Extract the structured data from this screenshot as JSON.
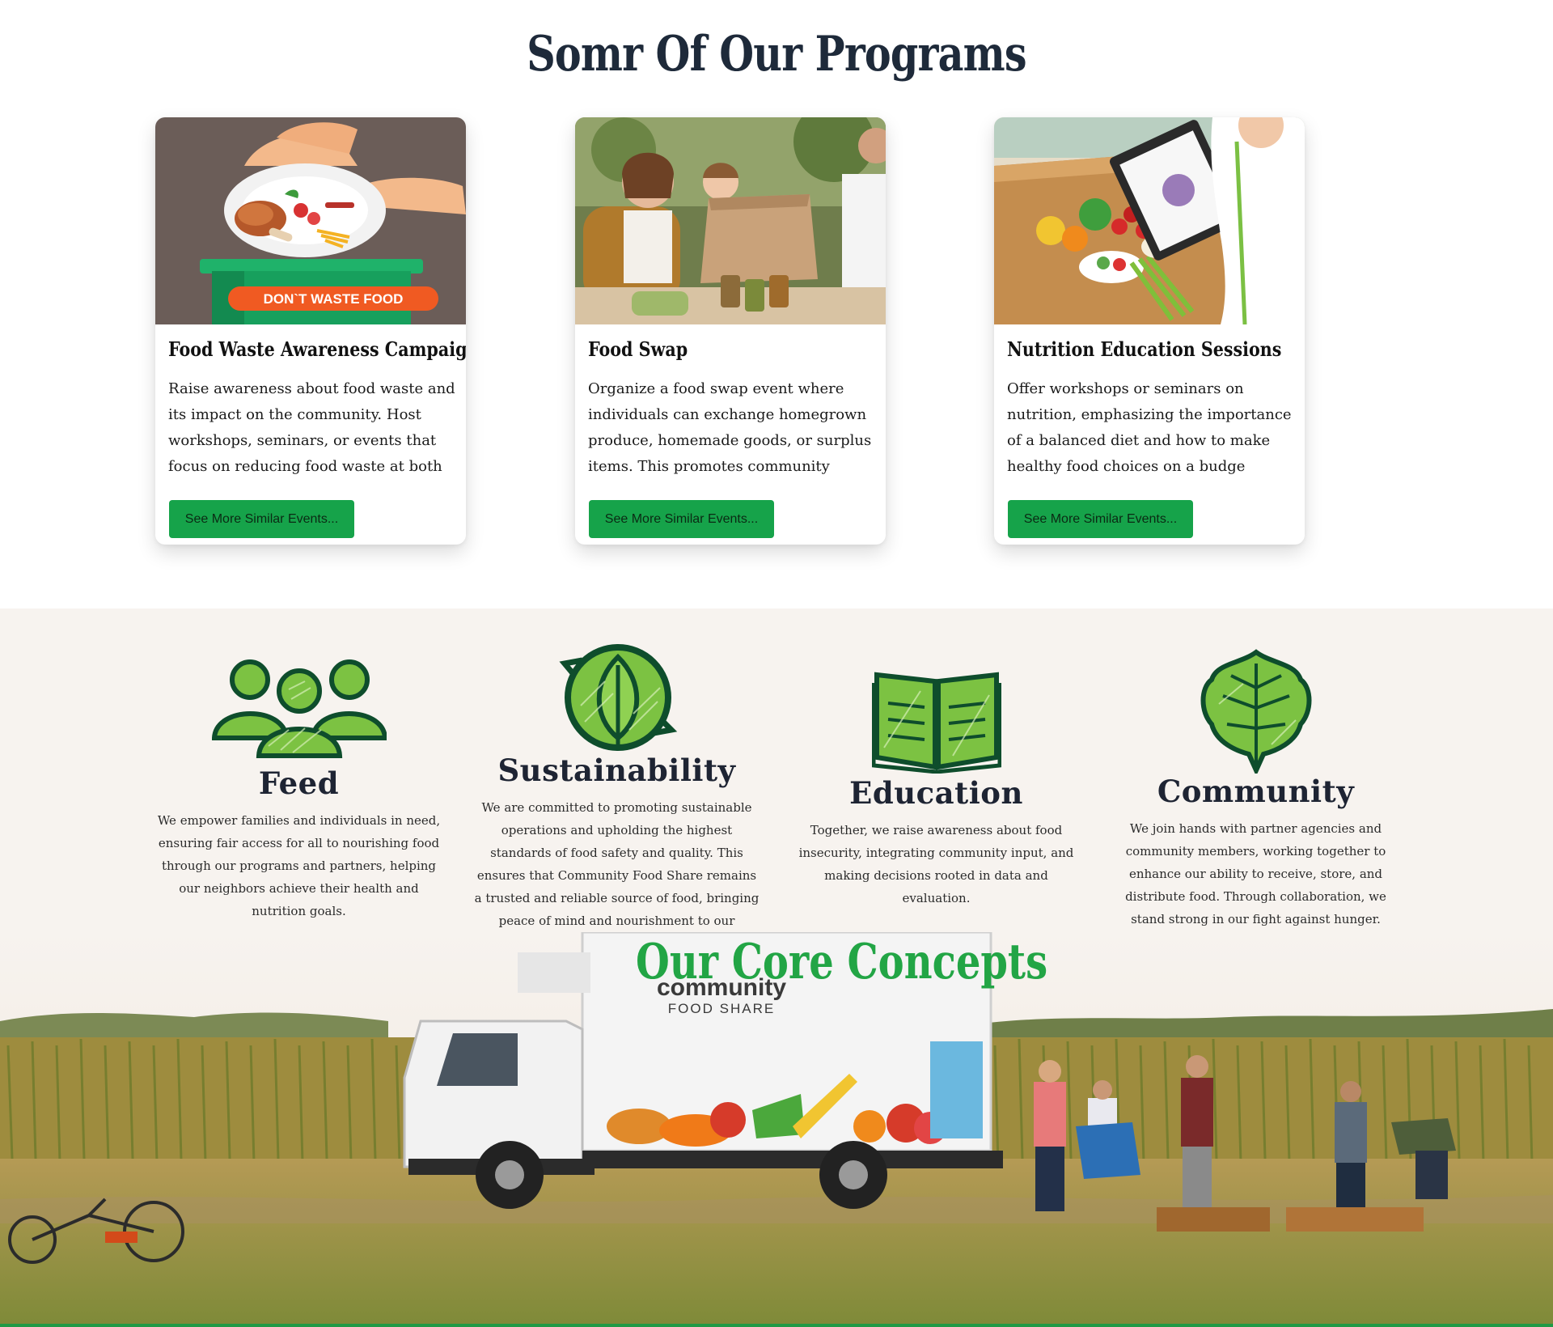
{
  "programs": {
    "title": "Somr Of Our Programs",
    "cards": [
      {
        "image": "dont-waste-food-illustration",
        "image_text": "DON`T WASTE FOOD",
        "title": "Food Waste Awareness Campaign",
        "text": "Raise awareness about food waste and its impact on the community. Host workshops, seminars, or events that focus on reducing food waste at both the individual and community",
        "button": "See More Similar Events..."
      },
      {
        "image": "food-swap-photo",
        "title": "Food Swap",
        "text": "Organize a food swap event where individuals can exchange homegrown produce, homemade goods, or surplus items. This promotes community sharing and reduces food waste",
        "button": "See More Similar Events..."
      },
      {
        "image": "nutrition-education-photo",
        "title": "Nutrition Education Sessions",
        "text": "Offer workshops or seminars on nutrition, emphasizing the importance of a balanced diet and how to make healthy food choices on a budge",
        "button": "See More Similar Events..."
      }
    ]
  },
  "concepts": {
    "title": "Our Core Concepts",
    "items": [
      {
        "icon": "people-group-icon",
        "name": "Feed",
        "text": "We empower families and individuals in need, ensuring fair access for all to nourishing food through our programs and partners, helping our neighbors achieve their health and nutrition goals."
      },
      {
        "icon": "recycle-leaf-icon",
        "name": "Sustainability",
        "text": "We are committed to promoting sustainable operations and upholding the highest standards of food safety and quality. This ensures that Community Food Share remains a trusted and reliable source of food, bringing peace of mind and nourishment to our community."
      },
      {
        "icon": "open-book-icon",
        "name": "Education",
        "text": "Together, we raise awareness about food insecurity, integrating community input, and making decisions rooted in data and evaluation."
      },
      {
        "icon": "leaf-icon",
        "name": "Community",
        "text": "We join hands with partner agencies and community members, working together to enhance our ability to receive, store, and distribute food. Through collaboration, we stand strong in our fight against hunger."
      }
    ],
    "truck": {
      "logo_top": "community",
      "logo_bottom": "FOOD SHARE"
    }
  },
  "colors": {
    "accent_green": "#16a34a",
    "title_green": "#22a545",
    "dark_navy": "#1e2a3a",
    "concepts_bg": "#f7f3ef"
  }
}
